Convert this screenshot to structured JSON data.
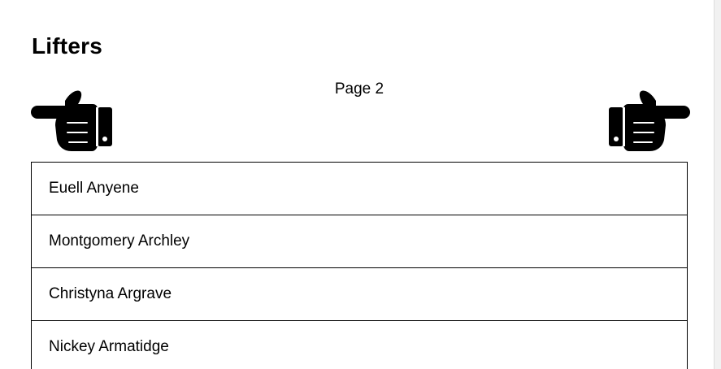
{
  "header": {
    "title": "Lifters"
  },
  "pagination": {
    "label": "Page 2",
    "prev_icon": "hand-pointing-left-icon",
    "next_icon": "hand-pointing-right-icon"
  },
  "lifters": [
    {
      "name": "Euell Anyene"
    },
    {
      "name": "Montgomery Archley"
    },
    {
      "name": "Christyna Argrave"
    },
    {
      "name": "Nickey Armatidge"
    }
  ]
}
